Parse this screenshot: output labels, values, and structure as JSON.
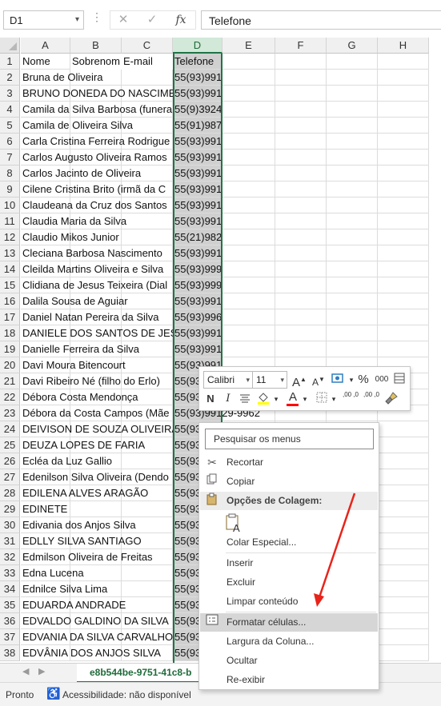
{
  "formula_bar": {
    "name_box": "D1",
    "cancel_icon": "close-icon",
    "enter_icon": "check-icon",
    "fx_label": "fx",
    "value": "Telefone"
  },
  "columns": [
    "A",
    "B",
    "C",
    "D",
    "E",
    "F",
    "G",
    "H"
  ],
  "selected_column": "D",
  "rows": [
    {
      "n": "1",
      "a": "Nome",
      "b": "Sobrenom",
      "c": "E-mail",
      "d": "Telefone"
    },
    {
      "n": "2",
      "a": "Bruna de Oliveira",
      "b": "",
      "c": "",
      "d": "55(93)991"
    },
    {
      "n": "3",
      "a": "BRUNO DONEDA DO NASCIMEN",
      "b": "",
      "c": "",
      "d": "55(93)991"
    },
    {
      "n": "4",
      "a": "Camila da Silva Barbosa (funera",
      "b": "",
      "c": "",
      "d": "55(9)3924"
    },
    {
      "n": "5",
      "a": "Camila de Oliveira Silva",
      "b": "",
      "c": "",
      "d": "55(91)987"
    },
    {
      "n": "6",
      "a": "Carla Cristina Ferreira Rodrigue",
      "b": "",
      "c": "",
      "d": "55(93)991"
    },
    {
      "n": "7",
      "a": "Carlos Augusto Oliveira Ramos",
      "b": "",
      "c": "",
      "d": "55(93)991"
    },
    {
      "n": "8",
      "a": "Carlos Jacinto de Oliveira",
      "b": "",
      "c": "",
      "d": "55(93)991"
    },
    {
      "n": "9",
      "a": "Cilene Cristina Brito (irmã da C",
      "b": "",
      "c": "",
      "d": "55(93)991"
    },
    {
      "n": "10",
      "a": "Claudeana da Cruz dos Santos",
      "b": "",
      "c": "",
      "d": "55(93)991"
    },
    {
      "n": "11",
      "a": "Claudia Maria da Silva",
      "b": "",
      "c": "",
      "d": "55(93)991"
    },
    {
      "n": "12",
      "a": "Claudio Mikos Junior",
      "b": "",
      "c": "",
      "d": "55(21)982"
    },
    {
      "n": "13",
      "a": "Cleciana Barbosa Nascimento",
      "b": "",
      "c": "",
      "d": "55(93)991"
    },
    {
      "n": "14",
      "a": "Cleilda Martins Oliveira e Silva",
      "b": "",
      "c": "",
      "d": "55(93)999"
    },
    {
      "n": "15",
      "a": "Clidiana de Jesus Teixeira (Dial",
      "b": "",
      "c": "",
      "d": "55(93)999"
    },
    {
      "n": "16",
      "a": "Dalila Sousa de Aguiar",
      "b": "",
      "c": "",
      "d": "55(93)991"
    },
    {
      "n": "17",
      "a": "Daniel Natan Pereira da Silva",
      "b": "",
      "c": "",
      "d": "55(93)996"
    },
    {
      "n": "18",
      "a": "DANIELE DOS SANTOS DE JESUS",
      "b": "",
      "c": "",
      "d": "55(93)991"
    },
    {
      "n": "19",
      "a": "Danielle Ferreira da Silva",
      "b": "",
      "c": "",
      "d": "55(93)991"
    },
    {
      "n": "20",
      "a": "Davi Moura Bitencourt",
      "b": "",
      "c": "",
      "d": "55(93)991"
    },
    {
      "n": "21",
      "a": "Davi Ribeiro Né (filho do Erlo)",
      "b": "",
      "c": "",
      "d": "55(93"
    },
    {
      "n": "22",
      "a": "Débora Costa Mendonça",
      "b": "",
      "c": "",
      "d": "55(93"
    },
    {
      "n": "23",
      "a": "Débora da Costa Campos (Mãe",
      "b": "",
      "c": "",
      "d": "55(93)99129-9962"
    },
    {
      "n": "24",
      "a": "DEIVISON DE SOUZA OLIVEIRA",
      "b": "",
      "c": "",
      "d": "55(93"
    },
    {
      "n": "25",
      "a": "DEUZA LOPES DE FARIA",
      "b": "",
      "c": "",
      "d": "55(93"
    },
    {
      "n": "26",
      "a": "Ecléa da Luz Gallio",
      "b": "",
      "c": "",
      "d": "55(93"
    },
    {
      "n": "27",
      "a": "Edenilson Silva Oliveira (Dendo",
      "b": "",
      "c": "",
      "d": "55(93"
    },
    {
      "n": "28",
      "a": "EDILENA ALVES ARAGÃO",
      "b": "",
      "c": "",
      "d": "55(93"
    },
    {
      "n": "29",
      "a": "EDINETE",
      "b": "",
      "c": "",
      "d": "55(93"
    },
    {
      "n": "30",
      "a": "Edivania dos Anjos Silva",
      "b": "",
      "c": "",
      "d": "55(93"
    },
    {
      "n": "31",
      "a": "EDLLY SILVA SANTIAGO",
      "b": "",
      "c": "",
      "d": "55(93"
    },
    {
      "n": "32",
      "a": "Edmilson Oliveira de Freitas",
      "b": "",
      "c": "",
      "d": "55(93"
    },
    {
      "n": "33",
      "a": "Edna Lucena",
      "b": "",
      "c": "",
      "d": "55(93"
    },
    {
      "n": "34",
      "a": "Ednilce Silva Lima",
      "b": "",
      "c": "",
      "d": "55(93"
    },
    {
      "n": "35",
      "a": "EDUARDA ANDRADE",
      "b": "",
      "c": "",
      "d": "55(93"
    },
    {
      "n": "36",
      "a": "EDVALDO GALDINO DA SILVA",
      "b": "",
      "c": "",
      "d": "55(93"
    },
    {
      "n": "37",
      "a": "EDVANIA DA SILVA CARVALHO",
      "b": "",
      "c": "",
      "d": "55(93"
    },
    {
      "n": "38",
      "a": "EDVÂNIA DOS ANJOS SILVA",
      "b": "",
      "c": "",
      "d": "55(93"
    }
  ],
  "mini_toolbar": {
    "font_name": "Calibri",
    "font_size": "11",
    "grow_font": "A",
    "shrink_font": "A",
    "percent": "%",
    "thousands": "000",
    "bold": "N",
    "italic": "I",
    "font_color_letter": "A",
    "fill_color": "#ffff00",
    "font_color": "#ff0000",
    "increase_decimals": ",00 ,0",
    "decrease_decimals": ",00 ,0"
  },
  "context_menu": {
    "search": "Pesquisar os menus",
    "items": {
      "recortar": "Recortar",
      "copiar": "Copiar",
      "opcoes_colagem": "Opções de Colagem:",
      "colar_especial": "Colar Especial...",
      "inserir": "Inserir",
      "excluir": "Excluir",
      "limpar": "Limpar conteúdo",
      "formatar": "Formatar células...",
      "largura": "Largura da Coluna...",
      "ocultar": "Ocultar",
      "reexibir": "Re-exibir"
    }
  },
  "sheet_tab": "e8b544be-9751-41c8-b",
  "status": {
    "ready": "Pronto",
    "accessibility": "Acessibilidade: não disponível"
  },
  "accent_color": "#217346",
  "annotation_color": "#e8231a"
}
